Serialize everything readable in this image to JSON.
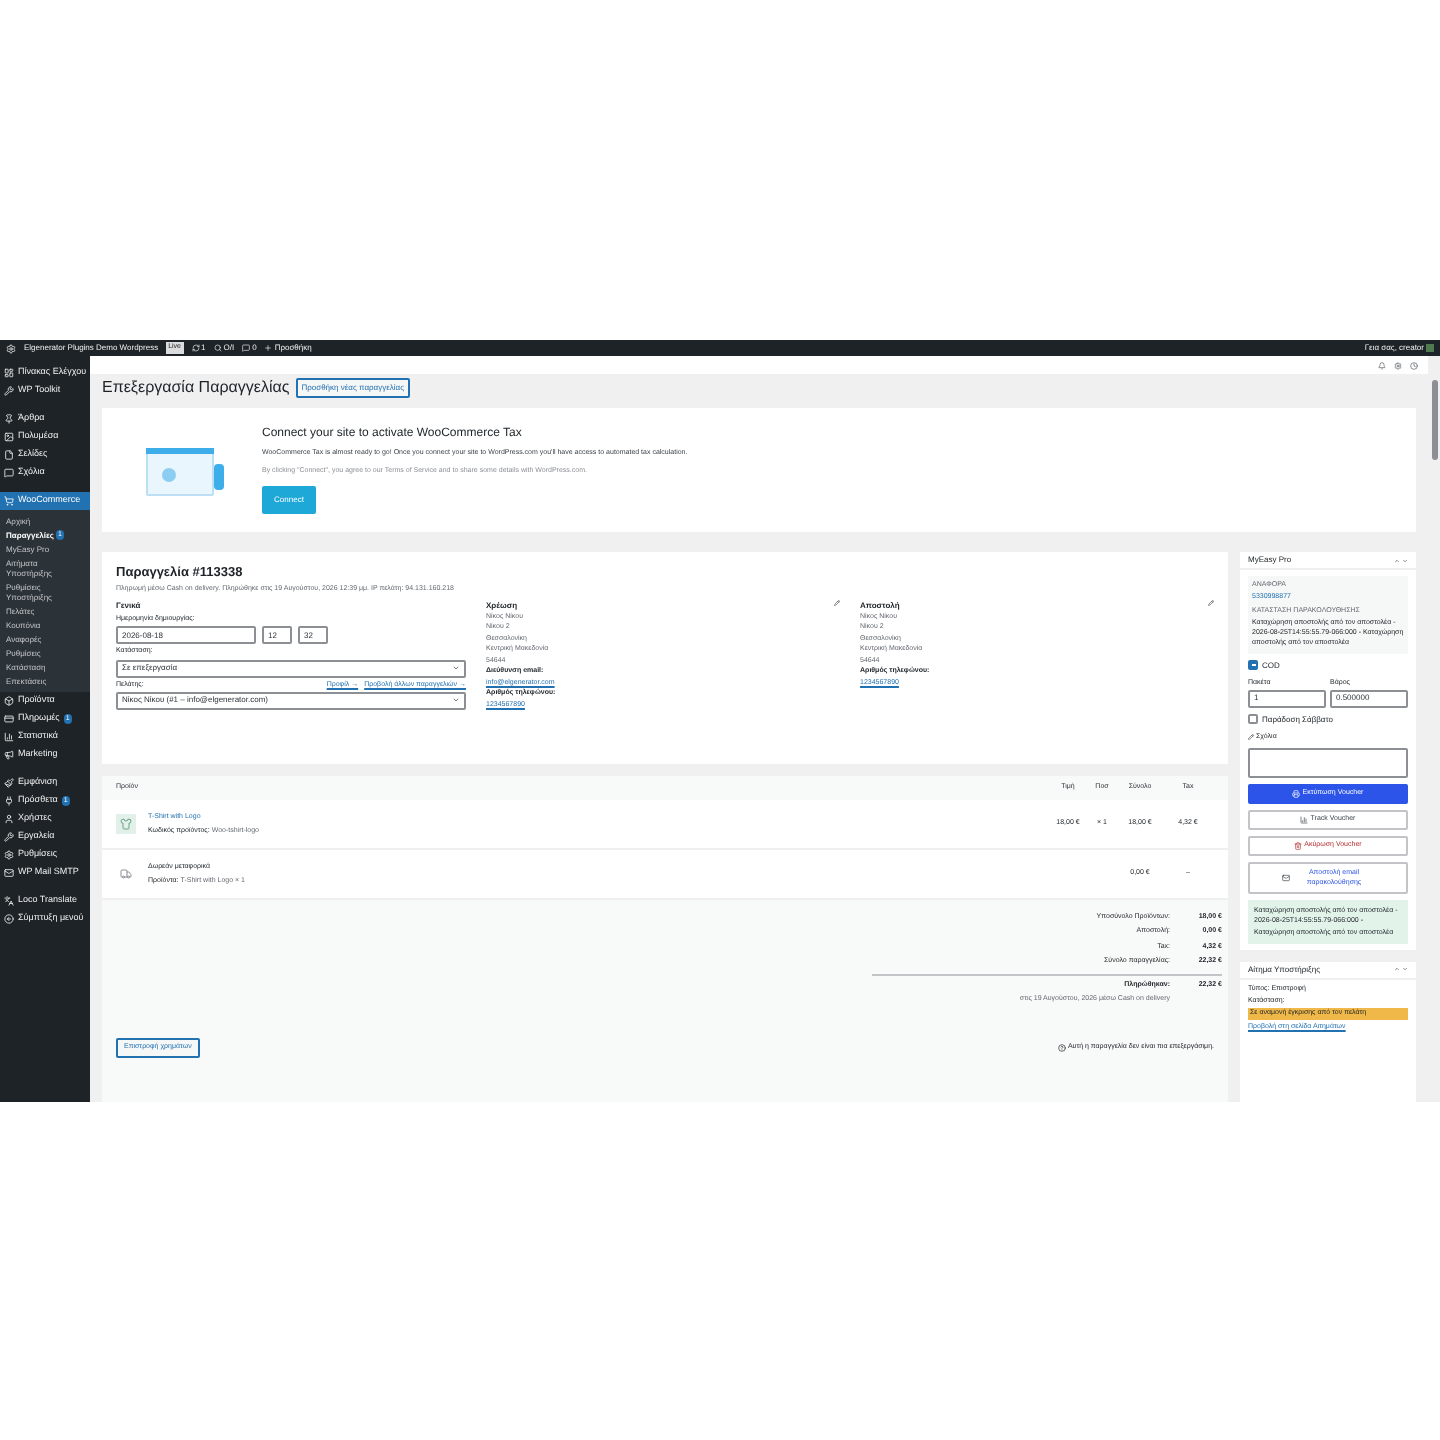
{
  "admin_bar": {
    "site": "Elgenerator Plugins Demo Wordpress",
    "badge": "Live",
    "updates": "1",
    "cache": "Ο/Ι",
    "comments": "0",
    "new": "Προσθήκη",
    "greeting": "Γεια σας, creator"
  },
  "sidebar": {
    "groups": [
      [
        {
          "label": "Πίνακας Ελέγχου",
          "selected": false
        },
        {
          "label": "WP Toolkit",
          "selected": false
        }
      ],
      [
        {
          "label": "Άρθρα",
          "selected": false
        },
        {
          "label": "Πολυμέσα",
          "selected": false
        },
        {
          "label": "Σελίδες",
          "selected": false
        },
        {
          "label": "Σχόλια",
          "selected": false
        }
      ],
      [
        {
          "label": "WooCommerce",
          "selected": true,
          "children": [
            {
              "label": "Αρχική",
              "selected": false
            },
            {
              "label": "Παραγγελίες",
              "badge": "1",
              "selected": true
            },
            {
              "label": "MyEasy Pro",
              "selected": false
            },
            {
              "label": "Αιτήματα Υποστήριξης",
              "selected": false
            },
            {
              "label": "Ρυθμίσεις Υποστήριξης",
              "selected": false
            },
            {
              "label": "Πελάτες",
              "selected": false
            },
            {
              "label": "Κουπόνια",
              "selected": false
            },
            {
              "label": "Αναφορές",
              "selected": false
            },
            {
              "label": "Ρυθμίσεις",
              "selected": false
            },
            {
              "label": "Κατάσταση",
              "selected": false
            },
            {
              "label": "Επεκτάσεις",
              "selected": false
            }
          ]
        },
        {
          "label": "Προϊόντα",
          "selected": false
        },
        {
          "label": "Πληρωμές",
          "badge": "1",
          "selected": false
        },
        {
          "label": "Στατιστικά",
          "selected": false
        },
        {
          "label": "Marketing",
          "selected": false
        }
      ],
      [
        {
          "label": "Εμφάνιση",
          "selected": false
        },
        {
          "label": "Πρόσθετα",
          "badge": "1",
          "selected": false
        },
        {
          "label": "Χρήστες",
          "selected": false
        },
        {
          "label": "Εργαλεία",
          "selected": false
        },
        {
          "label": "Ρυθμίσεις",
          "selected": false
        },
        {
          "label": "WP Mail SMTP",
          "selected": false
        }
      ],
      [
        {
          "label": "Loco Translate",
          "selected": false
        },
        {
          "label": "Σύμπτυξη μενού",
          "selected": false
        }
      ]
    ]
  },
  "page": {
    "title": "Επεξεργασία Παραγγελίας",
    "add_button": "Προσθήκη νέας παραγγελίας"
  },
  "tax_banner": {
    "title": "Connect your site to activate WooCommerce Tax",
    "text": "WooCommerce Tax is almost ready to go! Once you connect your site to WordPress.com you'll have access to automated tax calculation.",
    "terms": "By clicking \"Connect\", you agree to our Terms of Service and to share some details with WordPress.com.",
    "button": "Connect"
  },
  "order": {
    "title": "Παραγγελία #113338",
    "meta": "Πληρωμή μέσω Cash on delivery. Πληρώθηκε στις 19 Αυγούστου, 2026 12:39 μμ. IP πελάτη: 94.131.160.218",
    "general": {
      "heading": "Γενικά",
      "date_label": "Ημερομηνία δημιουργίας:",
      "date": "2026-08-18",
      "hour": "12",
      "minute": "32",
      "status_label": "Κατάσταση:",
      "status": "Σε επεξεργασία",
      "customer_label": "Πελάτης:",
      "profile_link": "Προφίλ →",
      "other_orders_link": "Προβολή άλλων παραγγελιών →",
      "customer": "Νίκος Νίκου (#1 – info@elgenerator.com)"
    },
    "billing": {
      "heading": "Χρέωση",
      "address": [
        "Νίκος Νίκου",
        "Νίκου 2",
        "Θεσσαλονίκη",
        "Κεντρική Μακεδονία",
        "54644"
      ],
      "email_label": "Διεύθυνση email:",
      "email": "info@elgenerator.com",
      "phone_label": "Αριθμός τηλεφώνου:",
      "phone": "1234567890"
    },
    "shipping": {
      "heading": "Αποστολή",
      "address": [
        "Νίκος Νίκου",
        "Νίκου 2",
        "Θεσσαλονίκη",
        "Κεντρική Μακεδονία",
        "54644"
      ],
      "phone_label": "Αριθμός τηλεφώνου:",
      "phone": "1234567890"
    }
  },
  "items": {
    "columns": [
      "Προϊόν",
      "Τιμή",
      "Ποσ",
      "Σύνολο",
      "Tax"
    ],
    "rows": [
      {
        "kind": "product",
        "name": "T-Shirt with Logo",
        "meta_label": "Κωδικός προϊόντος:",
        "meta": "Woo-tshirt-logo",
        "price": "18,00 €",
        "qty": "× 1",
        "total": "18,00 €",
        "tax": "4,32 €"
      },
      {
        "kind": "shipping",
        "name": "Δωρεάν μεταφορικά",
        "meta_label": "Προϊόντα:",
        "meta": "T-Shirt with Logo × 1",
        "price": "",
        "qty": "",
        "total": "0,00 €",
        "tax": "–"
      }
    ],
    "totals": [
      {
        "label": "Υποσύνολο Προϊόντων:",
        "value": "18,00 €"
      },
      {
        "label": "Αποστολή:",
        "value": "0,00 €"
      },
      {
        "label": "Tax:",
        "value": "4,32 €"
      },
      {
        "label": "Σύνολο παραγγελίας:",
        "value": "22,32 €"
      }
    ],
    "paid": {
      "label": "Πληρώθηκαν:",
      "value": "22,32 €",
      "note": "στις 19 Αυγούστου, 2026 μέσω Cash on delivery"
    },
    "refund_button": "Επιστροφή χρημάτων",
    "locked_note": "Αυτή η παραγγελία δεν είναι πια επεξεργάσιμη."
  },
  "myeasy": {
    "title": "MyEasy Pro",
    "ref_label": "ΑΝΑΦΟΡΑ",
    "ref": "5330998877",
    "tracking_label": "ΚΑΤΑΣΤΑΣΗ ΠΑΡΑΚΟΛΟΥΘΗΣΗΣ",
    "tracking": "Καταχώρηση αποστολής από τον αποστολέα - 2026-08-25T14:55:55.79-066:000 - Καταχώρηση αποστολής από τον αποστολέα",
    "cod": {
      "label": "COD",
      "checked": true
    },
    "packages_label": "Πακέτα",
    "packages": "1",
    "weight_label": "Βάρος",
    "weight": "0.500000",
    "saturday": {
      "label": "Παράδοση Σάββατο",
      "checked": false
    },
    "comments_label": "Σχόλια",
    "print": "Εκτύπωση Voucher",
    "track": "Track Voucher",
    "cancel": "Ακύρωση Voucher",
    "email": "Αποστολή email παρακολούθησης",
    "notice": "Καταχώρηση αποστολής από τον αποστολέα - 2026-08-25T14:55:55.79-066:000 - Καταχώρηση αποστολής από τον αποστολέα"
  },
  "support": {
    "title": "Αίτημα Υποστήριξης",
    "type": "Τύπος: Επιστροφή",
    "status_label": "Κατάσταση:",
    "status": "Σε αναμονή έγκρισης από τον πελάτη",
    "link": "Προβολή στη σελίδα Αιτημάτων"
  }
}
